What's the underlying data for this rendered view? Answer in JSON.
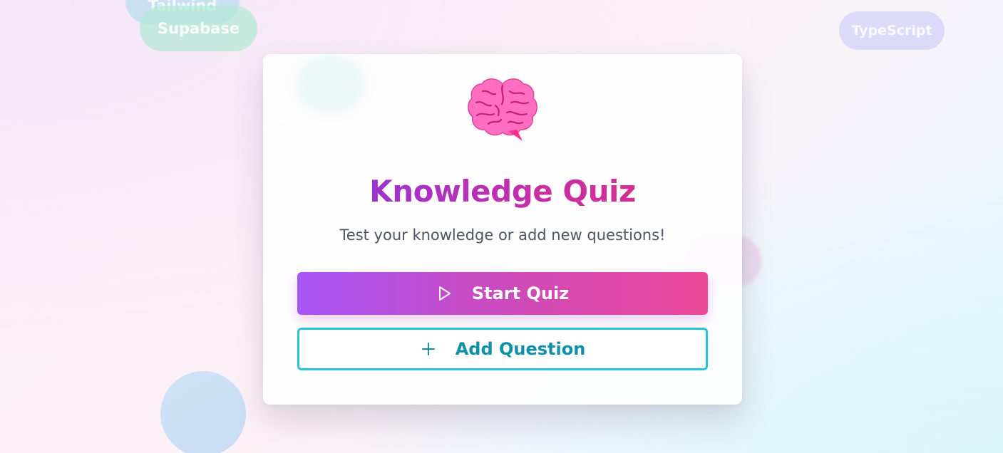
{
  "background": {
    "bubbles": [
      {
        "label": "Tailwind"
      },
      {
        "label": "Supabase"
      },
      {
        "label": "TypeScript"
      }
    ]
  },
  "card": {
    "icon": "brain-icon",
    "title": "Knowledge Quiz",
    "subtitle": "Test your knowledge or add new questions!",
    "start_button": {
      "label": "Start Quiz",
      "icon": "play-icon"
    },
    "add_button": {
      "label": "Add Question",
      "icon": "plus-icon"
    }
  },
  "colors": {
    "title_gradient_start": "#9b34cf",
    "title_gradient_end": "#d42f91",
    "start_gradient_start": "#a855f7",
    "start_gradient_end": "#ec4899",
    "add_border": "#22c5dd",
    "add_text": "#0e90a8",
    "brain": "#ff69b4"
  }
}
